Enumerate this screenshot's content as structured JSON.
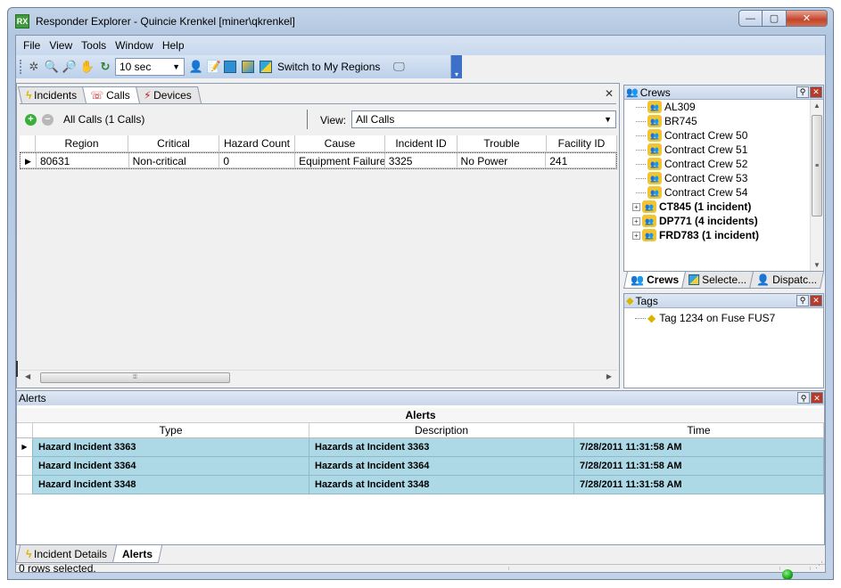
{
  "window": {
    "app_icon": "RX",
    "title": "Responder Explorer - Quincie Krenkel [miner\\qkrenkel]",
    "minimize": "—",
    "maximize": "▢",
    "close": "✕"
  },
  "menu": [
    "File",
    "View",
    "Tools",
    "Window",
    "Help"
  ],
  "toolbar": {
    "refresh_interval": "10 sec",
    "switch_label": "Switch to My Regions",
    "icons": [
      "sun-icon",
      "zoom-in-icon",
      "zoom-out-icon",
      "pan-hand-icon",
      "refresh-icon",
      "crew-person-icon",
      "notes-icon",
      "map-icon",
      "map-color-icon",
      "region-icon",
      "monitor-icon"
    ]
  },
  "main_tabs": [
    {
      "label": "Incidents",
      "icon": "lightning-icon"
    },
    {
      "label": "Calls",
      "icon": "phone-icon"
    },
    {
      "label": "Devices",
      "icon": "device-icon"
    }
  ],
  "calls": {
    "count_label": "All Calls (1 Calls)",
    "view_label": "View:",
    "view_value": "All Calls",
    "columns": [
      "Region",
      "Critical",
      "Hazard Count",
      "Cause",
      "Incident ID",
      "Trouble",
      "Facility ID"
    ],
    "rows": [
      [
        "80631",
        "Non-critical",
        "0",
        "Equipment Failure",
        "3325",
        "No Power",
        "241"
      ]
    ]
  },
  "crews": {
    "title": "Crews",
    "items": [
      {
        "label": "AL309",
        "bold": false,
        "expandable": false
      },
      {
        "label": "BR745",
        "bold": false,
        "expandable": false
      },
      {
        "label": "Contract Crew 50",
        "bold": false,
        "expandable": false
      },
      {
        "label": "Contract Crew 51",
        "bold": false,
        "expandable": false
      },
      {
        "label": "Contract Crew 52",
        "bold": false,
        "expandable": false
      },
      {
        "label": "Contract Crew 53",
        "bold": false,
        "expandable": false
      },
      {
        "label": "Contract Crew 54",
        "bold": false,
        "expandable": false
      },
      {
        "label": "CT845 (1 incident)",
        "bold": true,
        "expandable": true
      },
      {
        "label": "DP771 (4 incidents)",
        "bold": true,
        "expandable": true
      },
      {
        "label": "FRD783 (1 incident)",
        "bold": true,
        "expandable": true
      }
    ],
    "tabs": [
      "Crews",
      "Selecte...",
      "Dispatc..."
    ]
  },
  "tags": {
    "title": "Tags",
    "items": [
      "Tag 1234 on Fuse FUS7"
    ]
  },
  "alerts": {
    "title": "Alerts",
    "grid_caption": "Alerts",
    "columns": [
      "Type",
      "Description",
      "Time"
    ],
    "rows": [
      [
        "Hazard Incident 3363",
        "Hazards at Incident 3363",
        "7/28/2011 11:31:58 AM"
      ],
      [
        "Hazard Incident 3364",
        "Hazards at Incident 3364",
        "7/28/2011 11:31:58 AM"
      ],
      [
        "Hazard Incident 3348",
        "Hazards at Incident 3348",
        "7/28/2011 11:31:58 AM"
      ]
    ]
  },
  "bottom_tabs": [
    "Incident Details",
    "Alerts"
  ],
  "status": {
    "text": "0 rows selected.",
    "indicator_color": "#13a313"
  }
}
